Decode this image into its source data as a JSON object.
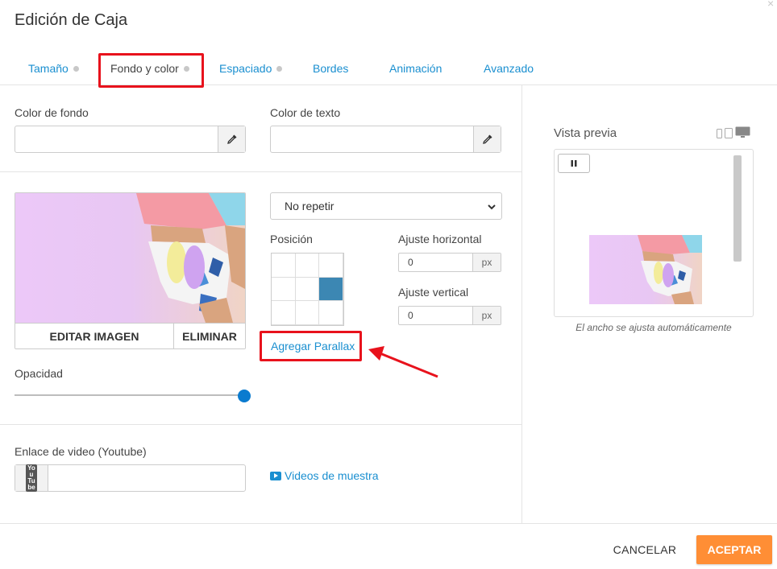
{
  "dialog": {
    "title": "Edición de Caja"
  },
  "tabs": [
    {
      "label": "Tamaño",
      "has_dot": true
    },
    {
      "label": "Fondo y color",
      "has_dot": true,
      "active": true
    },
    {
      "label": "Espaciado",
      "has_dot": true
    },
    {
      "label": "Bordes",
      "has_dot": false
    },
    {
      "label": "Animación",
      "has_dot": false
    },
    {
      "label": "Avanzado",
      "has_dot": false
    }
  ],
  "colors": {
    "background_label": "Color de fondo",
    "background_value": "",
    "text_label": "Color de texto",
    "text_value": "",
    "picker_icon": "eyedropper-icon"
  },
  "image": {
    "edit_label": "EDITAR IMAGEN",
    "delete_label": "ELIMINAR"
  },
  "repeat": {
    "selected": "No repetir"
  },
  "position": {
    "label": "Posición",
    "selected_cell": {
      "row": 2,
      "col": 3
    }
  },
  "offsets": {
    "horizontal_label": "Ajuste horizontal",
    "horizontal_value": "0",
    "vertical_label": "Ajuste vertical",
    "vertical_value": "0",
    "unit": "px"
  },
  "parallax": {
    "link_label": "Agregar Parallax"
  },
  "opacity": {
    "label": "Opacidad",
    "value_fraction": 1.0
  },
  "video": {
    "label": "Enlace de video (Youtube)",
    "value": "",
    "icon_text": "You Tube",
    "sample_link": "Videos de muestra"
  },
  "preview": {
    "label": "Vista previa",
    "note": "El ancho se ajusta automáticamente"
  },
  "footer": {
    "cancel_label": "CANCELAR",
    "accept_label": "ACEPTAR"
  },
  "theme": {
    "accent": "#1a8fd0",
    "highlight": "#e8121c",
    "accept": "#ff8e35",
    "selected_cell": "#3c87b3",
    "slider": "#0a7bcf"
  }
}
